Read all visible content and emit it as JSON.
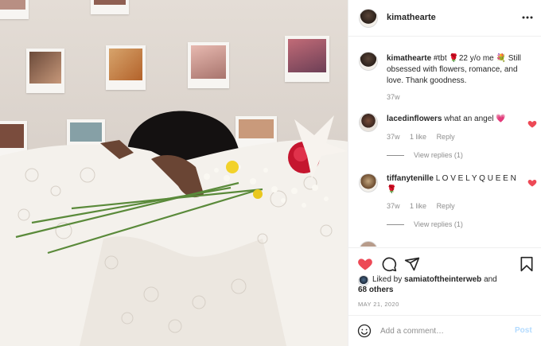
{
  "post": {
    "username": "kimathearte",
    "caption": {
      "username": "kimathearte",
      "text": "#tbt 🌹22 y/o me 💐 Still obsessed with flowers, romance, and love. Thank goodness.",
      "age": "37w"
    },
    "comments": [
      {
        "username": "lacedinflowers",
        "text": "what an angel 💗",
        "age": "37w",
        "likes": "1 like",
        "reply_label": "Reply",
        "view_replies": "View replies (1)"
      },
      {
        "username": "tiffanytenille",
        "text": "L O V E L Y Q U E E N 🌹",
        "age": "37w",
        "likes": "1 like",
        "reply_label": "Reply",
        "view_replies": "View replies (1)"
      }
    ],
    "liked_by": {
      "prefix": "Liked by",
      "user": "samiatoftheinterweb",
      "joiner": "and",
      "others": "68 others"
    },
    "date": "MAY 21, 2020",
    "add_comment": {
      "placeholder": "Add a comment…",
      "post_label": "Post"
    }
  },
  "colors": {
    "like_red": "#ed4956",
    "post_blue_disabled": "#b3dbff",
    "muted_text": "#8e8e8e"
  },
  "icons": {
    "more": "more-icon",
    "like": "heart-icon",
    "comment": "comment-icon",
    "share": "share-icon",
    "save": "bookmark-icon",
    "emoji": "emoji-icon"
  }
}
